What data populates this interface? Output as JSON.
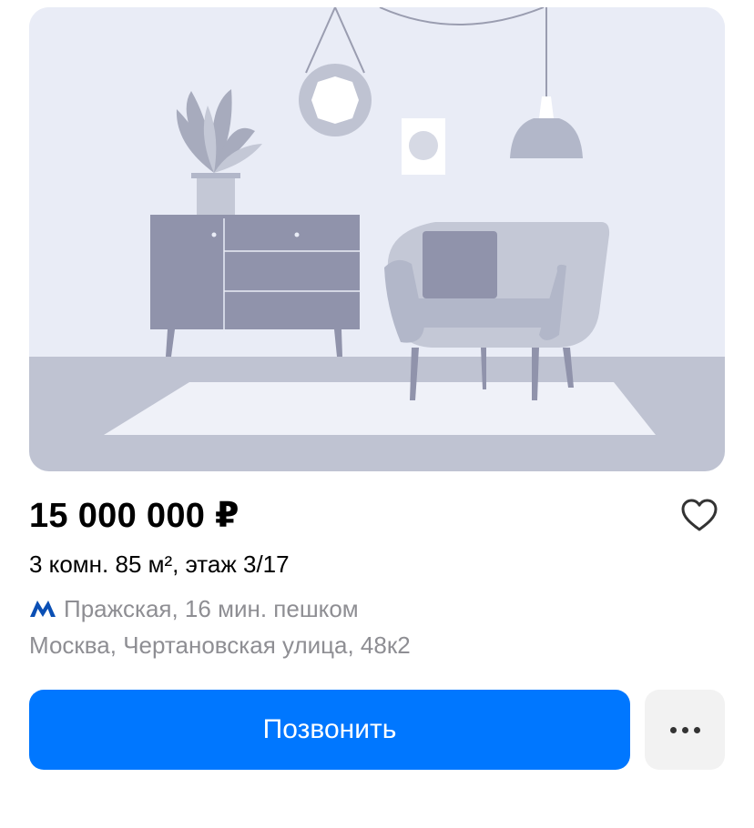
{
  "listing": {
    "price": "15 000 000 ₽",
    "summary": "3 комн. 85 м², этаж 3/17",
    "metro": "Пражская, 16 мин. пешком",
    "address": "Москва, Чертановская улица, 48к2"
  },
  "actions": {
    "call_label": "Позвонить"
  },
  "icons": {
    "favorite": "heart-outline-icon",
    "metro": "moscow-metro-m-icon",
    "more": "ellipsis-icon"
  },
  "colors": {
    "accent": "#0077ff",
    "metro": "#0a4fb4",
    "secondary_text": "#8e8e93",
    "placeholder_bg": "#e9ecf6"
  }
}
